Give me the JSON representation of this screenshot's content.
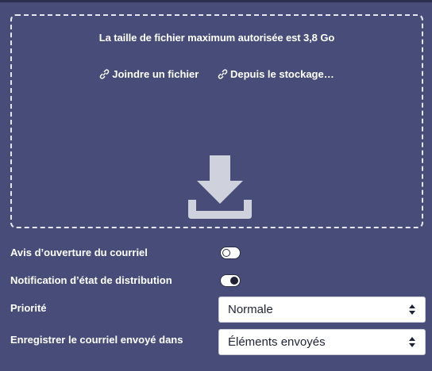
{
  "upload": {
    "max_size_text": "La taille de fichier maximum autorisée est 3,8 Go",
    "attach_link": "Joindre un fichier",
    "storage_link": "Depuis le stockage…",
    "drop_icon": "download-icon",
    "link_icon": "link-icon"
  },
  "options": {
    "read_receipt": {
      "label": "Avis d’ouverture du courriel",
      "enabled": false
    },
    "delivery_notification": {
      "label": "Notification d’état de distribution",
      "enabled": true
    },
    "priority": {
      "label": "Priorité",
      "value": "Normale"
    },
    "save_sent": {
      "label": "Enregistrer le courriel envoyé dans",
      "value": "Éléments envoyés"
    }
  },
  "colors": {
    "background": "#474c78",
    "dropzone_border": "#e6e7ef",
    "icon": "#cfd2dc",
    "select_text": "#1f2236"
  }
}
